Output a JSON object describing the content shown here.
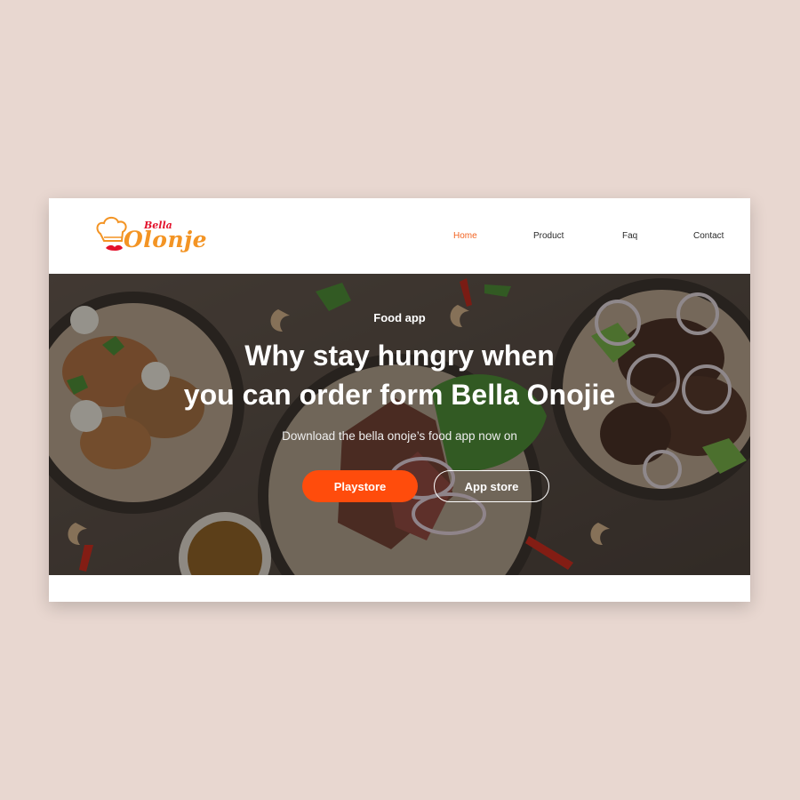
{
  "brand": {
    "logo_top": "Bella",
    "logo_main": "Olonje",
    "colors": {
      "accent": "#ff4c0c",
      "logo_orange": "#f39424",
      "logo_red": "#e3122c"
    },
    "icon": "chef-hat-icon"
  },
  "nav": {
    "items": [
      {
        "label": "Home",
        "active": true
      },
      {
        "label": "Product",
        "active": false
      },
      {
        "label": "Faq",
        "active": false
      },
      {
        "label": "Contact",
        "active": false
      }
    ]
  },
  "hero": {
    "eyebrow": "Food app",
    "headline_line1": "Why stay hungry when",
    "headline_line2": "you can order form Bella Onojie",
    "subtitle": "Download the bella onoje’s food app now on",
    "buttons": {
      "playstore": "Playstore",
      "appstore": "App store"
    }
  }
}
